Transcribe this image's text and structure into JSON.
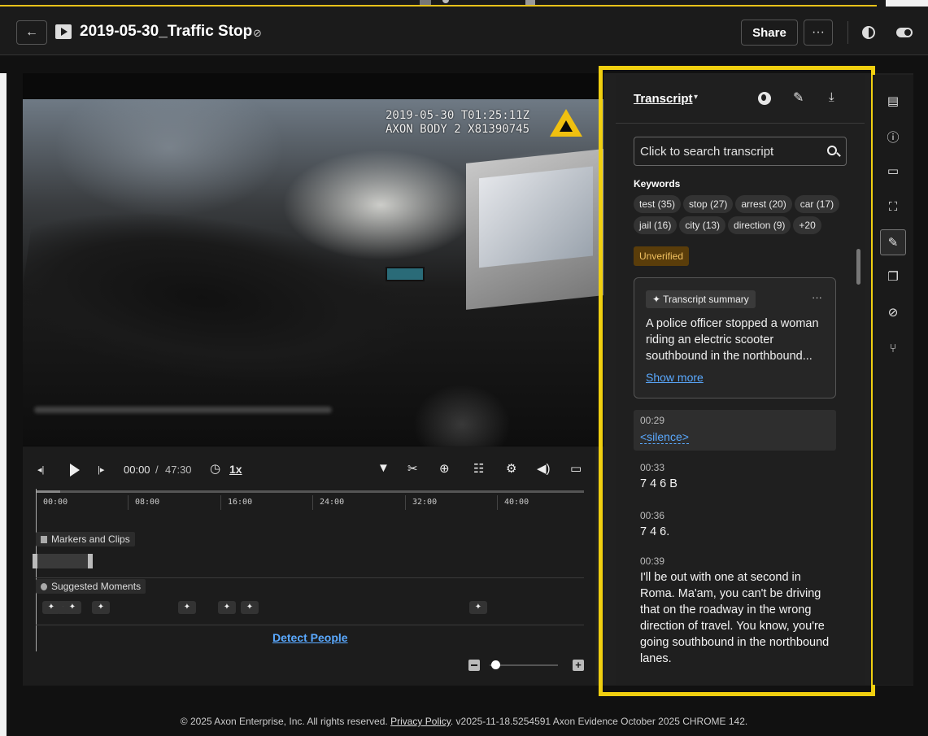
{
  "header": {
    "back_icon": "←",
    "title": "2019-05-30_Traffic Stop",
    "hidden_icon": "⊘",
    "share_label": "Share",
    "more_label": "···"
  },
  "video": {
    "overlay_line1": "2019-05-30 T01:25:11Z",
    "overlay_line2": "AXON BODY 2 X81390745"
  },
  "player": {
    "current_time": "00:00",
    "separator": "/",
    "total_time": "47:30",
    "speed": "1x",
    "prev_icon": "◂|",
    "next_icon": "|▸",
    "speed_icon": "◷",
    "toolbar_icons": {
      "bookmark": "▼",
      "clip": "✂",
      "zoom": "⊕",
      "adjust": "☷",
      "settings": "⚙",
      "volume": "◀)",
      "fullscreen": "▭"
    }
  },
  "timeline": {
    "ticks": [
      "00:00",
      "08:00",
      "16:00",
      "24:00",
      "32:00",
      "40:00"
    ],
    "markers_label": "Markers and Clips",
    "moments_label": "Suggested Moments",
    "moment_glyph": "✦",
    "detect_people": "Detect People",
    "zoom_plus": "+"
  },
  "transcript": {
    "collapse_icon": "›",
    "title": "Transcript",
    "caret": "▾",
    "edit_icon": "✎",
    "download_icon": "⤓",
    "search_placeholder": "Click to search transcript",
    "keywords_title": "Keywords",
    "keywords": [
      "test (35)",
      "stop (27)",
      "arrest (20)",
      "car (17)",
      "jail (16)",
      "city (13)",
      "direction (9)",
      "+20"
    ],
    "status_badge": "Unverified",
    "summary_badge": "✦ Transcript summary",
    "summary_more": "···",
    "summary_text": "A police officer stopped a woman riding an electric scooter southbound in the northbound...",
    "show_more": "Show more",
    "entries": [
      {
        "time": "00:29",
        "text": "<silence>"
      },
      {
        "time": "00:33",
        "text": "7 4 6 B"
      },
      {
        "time": "00:36",
        "text": "7 4 6."
      },
      {
        "time": "00:39",
        "text": "I'll be out with one at second in Roma. Ma'am, you can't be driving that on the roadway in the wrong direction of travel. You know, you're going southbound in the northbound lanes."
      }
    ]
  },
  "rail": {
    "icons": [
      "▤",
      "ⓘ",
      "▭",
      "⛶",
      "✎",
      "❐",
      "⊘",
      "⑂"
    ]
  },
  "footer": {
    "prefix": "© 2025 Axon Enterprise, Inc. All rights reserved.",
    "privacy": "Privacy Policy",
    "suffix": ". v2025-11-18.5254591 Axon Evidence October 2025 CHROME 142."
  },
  "colors": {
    "highlight": "#f0cf10",
    "link": "#5aa9ff",
    "unverified_bg": "#5a3d0a",
    "unverified_fg": "#f0c060"
  }
}
